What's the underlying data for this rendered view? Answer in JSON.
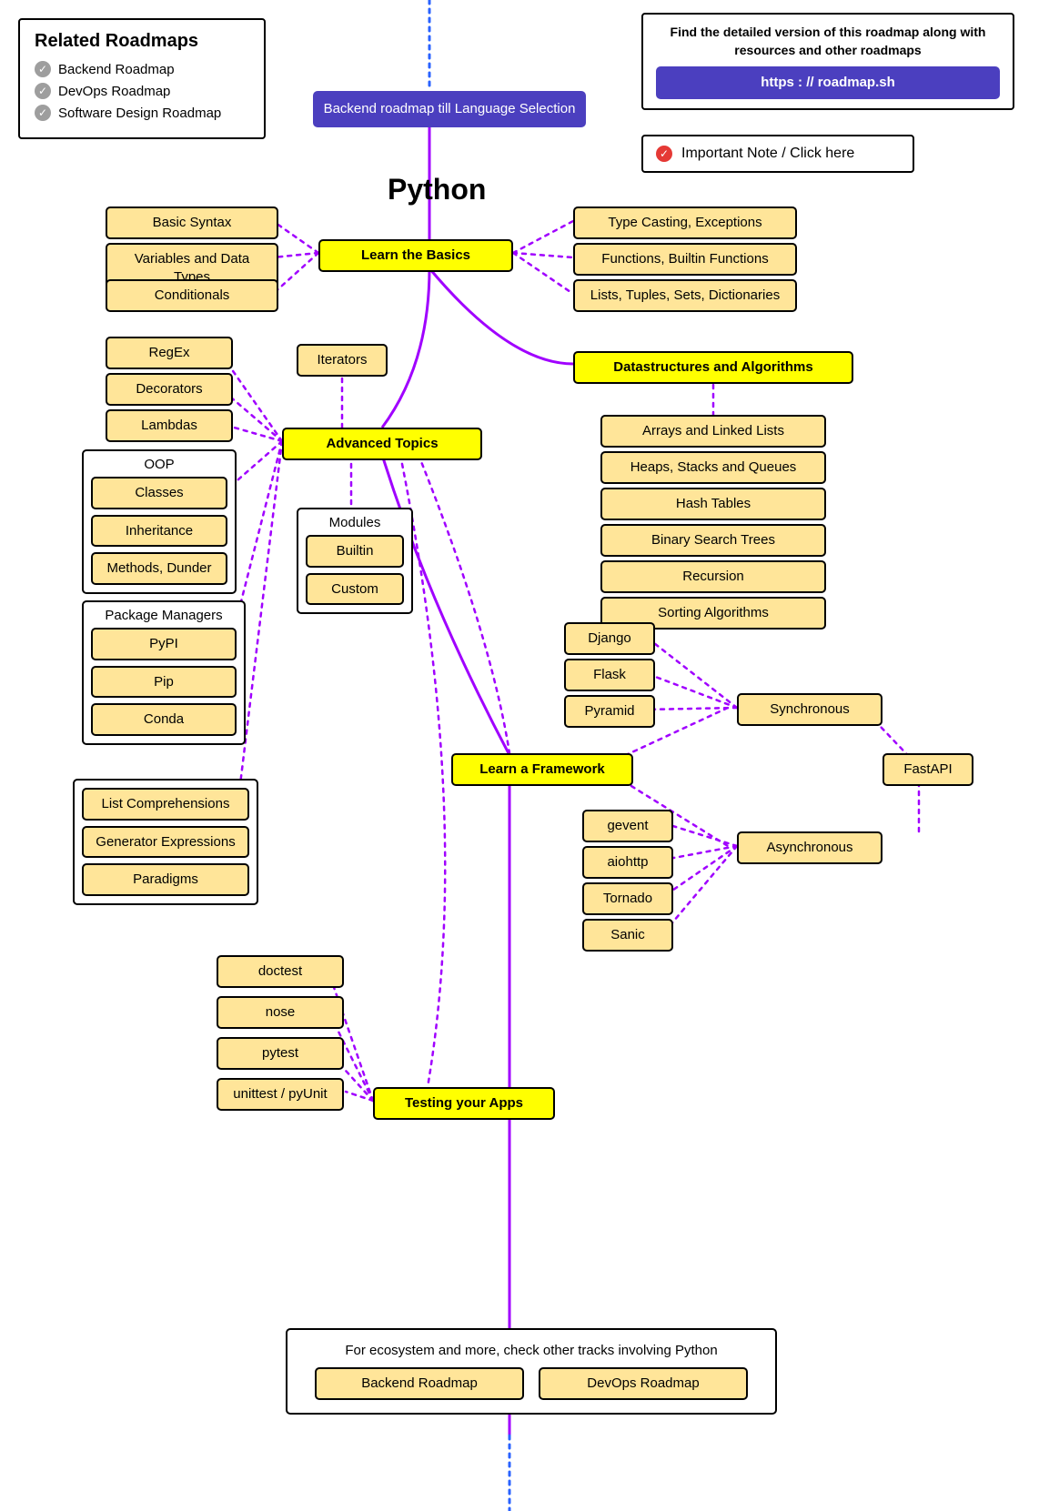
{
  "related": {
    "title": "Related Roadmaps",
    "items": [
      "Backend Roadmap",
      "DevOps Roadmap",
      "Software Design Roadmap"
    ]
  },
  "info": {
    "text": "Find the detailed version of this roadmap along with resources and other roadmaps",
    "link_label": "https : // roadmap.sh"
  },
  "important": {
    "label": "Important Note / Click here"
  },
  "backend_link": "Backend roadmap till Language Selection",
  "title": "Python",
  "basics": {
    "hub": "Learn the Basics",
    "left": [
      "Basic Syntax",
      "Variables and Data Types",
      "Conditionals"
    ],
    "right": [
      "Type Casting, Exceptions",
      "Functions, Builtin Functions",
      "Lists, Tuples, Sets, Dictionaries"
    ]
  },
  "advanced": {
    "hub": "Advanced Topics",
    "iterators": "Iterators",
    "left": [
      "RegEx",
      "Decorators",
      "Lambdas"
    ],
    "oop": {
      "title": "OOP",
      "items": [
        "Classes",
        "Inheritance",
        "Methods, Dunder"
      ]
    },
    "modules": {
      "title": "Modules",
      "items": [
        "Builtin",
        "Custom"
      ]
    },
    "pkg": {
      "title": "Package Managers",
      "items": [
        "PyPI",
        "Pip",
        "Conda"
      ]
    },
    "misc": [
      "List Comprehensions",
      "Generator Expressions",
      "Paradigms"
    ]
  },
  "dsa": {
    "hub": "Datastructures and Algorithms",
    "items": [
      "Arrays and Linked Lists",
      "Heaps, Stacks and Queues",
      "Hash Tables",
      "Binary Search Trees",
      "Recursion",
      "Sorting Algorithms"
    ]
  },
  "framework": {
    "hub": "Learn a Framework",
    "sync": {
      "label": "Synchronous",
      "items": [
        "Django",
        "Flask",
        "Pyramid"
      ]
    },
    "async": {
      "label": "Asynchronous",
      "fastapi": "FastAPI",
      "items": [
        "gevent",
        "aiohttp",
        "Tornado",
        "Sanic"
      ]
    }
  },
  "testing": {
    "hub": "Testing your Apps",
    "items": [
      "doctest",
      "nose",
      "pytest",
      "unittest / pyUnit"
    ]
  },
  "ecosystem": {
    "text": "For ecosystem and more, check other tracks involving Python",
    "items": [
      "Backend Roadmap",
      "DevOps Roadmap"
    ]
  }
}
